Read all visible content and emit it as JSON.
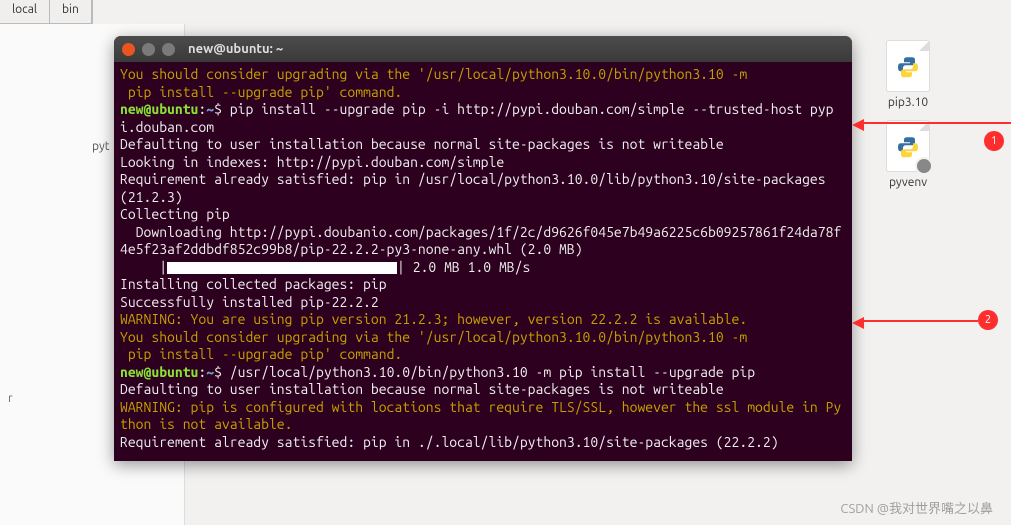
{
  "breadcrumb": {
    "item0": "local",
    "item1": "bin"
  },
  "desktop": {
    "icon0": {
      "label": "pip3.10"
    },
    "icon1": {
      "label": "pyvenv"
    }
  },
  "sidebar_hint": "r",
  "fm_label": "pyt",
  "terminal": {
    "title": "new@ubuntu: ~",
    "prompt_user": "new@ubuntu",
    "prompt_path": "~",
    "prompt_sep": ":",
    "prompt_dollar": "$",
    "warn1_l1": "You should consider upgrading via the '/usr/local/python3.10.0/bin/python3.10 -m",
    "warn1_l2": " pip install --upgrade pip' command.",
    "cmd1": " pip install --upgrade pip -i http://pypi.douban.com/simple --trusted-host pypi.douban.com",
    "out1": "Defaulting to user installation because normal site-packages is not writeable",
    "out2": "Looking in indexes: http://pypi.douban.com/simple",
    "out3": "Requirement already satisfied: pip in /usr/local/python3.10.0/lib/python3.10/site-packages (21.2.3)",
    "out4": "Collecting pip",
    "out5": "  Downloading http://pypi.doubanio.com/packages/1f/2c/d9626f045e7b49a6225c6b09257861f24da78f4e5f23af2ddbdf852c99b8/pip-22.2.2-py3-none-any.whl (2.0 MB)",
    "progress_pre": "     |",
    "progress_post": "| 2.0 MB 1.0 MB/s",
    "out6": "Installing collected packages: pip",
    "out7": "Successfully installed pip-22.2.2",
    "warn2_l1": "WARNING: You are using pip version 21.2.3; however, version 22.2.2 is available.",
    "warn2_l2": "You should consider upgrading via the '/usr/local/python3.10.0/bin/python3.10 -m",
    "warn2_l3": " pip install --upgrade pip' command.",
    "cmd2": " /usr/local/python3.10.0/bin/python3.10 -m pip install --upgrade pip",
    "out8": "Defaulting to user installation because normal site-packages is not writeable",
    "warn3": "WARNING: pip is configured with locations that require TLS/SSL, however the ssl module in Python is not available.",
    "out9": "Requirement already satisfied: pip in ./.local/lib/python3.10/site-packages (22.2.2)"
  },
  "annotations": {
    "badge1": "1",
    "badge2": "2"
  },
  "watermark": "CSDN @我对世界嘴之以鼻"
}
